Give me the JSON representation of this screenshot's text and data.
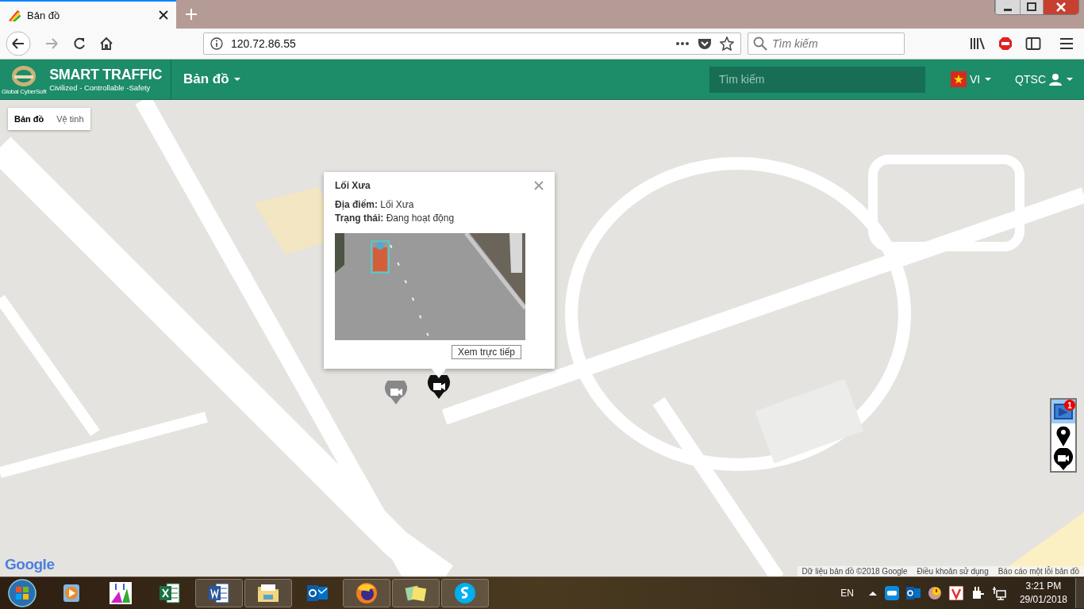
{
  "browser": {
    "tabs": [
      {
        "title": "Bản đồ",
        "selected": true
      }
    ],
    "address": "120.72.86.55",
    "search": {
      "placeholder": "Tìm kiếm"
    }
  },
  "app": {
    "brand": {
      "title": "SMART TRAFFIC",
      "tagline": "Civilized - Controllable -Safety",
      "logo_caption": "Global CyberSoft"
    },
    "menu": "Bản đồ",
    "search": {
      "placeholder": "Tìm kiếm"
    },
    "language": "VI",
    "user": "QTSC"
  },
  "map": {
    "map_types": [
      {
        "label": "Bản đồ",
        "selected": true
      },
      {
        "label": "Vệ tinh",
        "selected": false
      }
    ],
    "popup": {
      "title": "Lối Xưa",
      "fields": [
        {
          "label": "Địa điểm:",
          "value": "Lối Xưa"
        },
        {
          "label": "Trạng thái:",
          "value": "Đang hoạt động"
        }
      ],
      "button": "Xem trực tiếp"
    },
    "markers": [
      {
        "kind": "camera",
        "active": false
      },
      {
        "kind": "camera",
        "active": true
      }
    ],
    "layer_controls": [
      {
        "kind": "notifications",
        "badge": "1",
        "selected": true
      },
      {
        "kind": "places",
        "selected": false
      },
      {
        "kind": "cameras",
        "selected": false
      }
    ],
    "logo": "Google",
    "attribution": [
      "Dữ liệu bản đồ ©2018 Google",
      "Điều khoản sử dụng",
      "Báo cáo một lỗi bản đồ"
    ]
  },
  "taskbar": {
    "apps": [
      {
        "kind": "media",
        "open": false
      },
      {
        "kind": "music",
        "open": false
      },
      {
        "kind": "spreadsheet",
        "open": false
      },
      {
        "kind": "document",
        "open": true
      },
      {
        "kind": "folder",
        "open": true
      },
      {
        "kind": "mail",
        "open": false
      },
      {
        "kind": "browser",
        "open": true
      },
      {
        "kind": "notes",
        "open": true
      },
      {
        "kind": "chat",
        "open": true
      }
    ],
    "language": "EN",
    "time": "3:21 PM",
    "date": "29/01/2018"
  }
}
